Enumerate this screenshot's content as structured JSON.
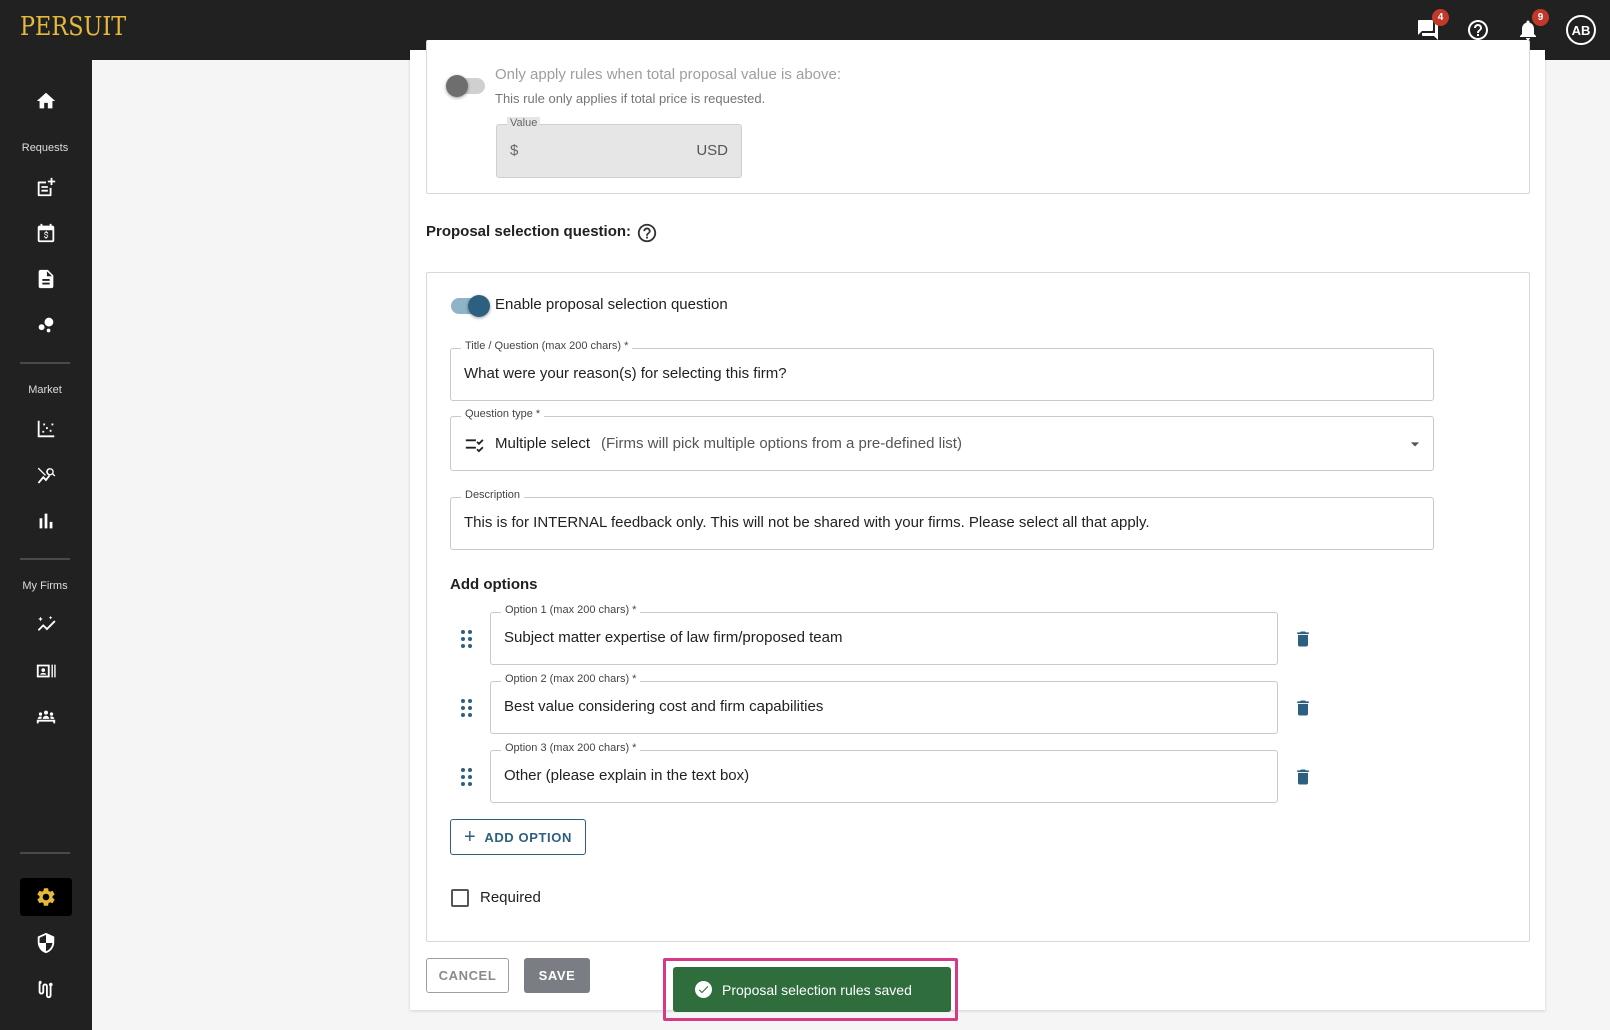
{
  "app": {
    "logo": "PERSUIT"
  },
  "topbar": {
    "messages_badge": "4",
    "notifications_badge": "9",
    "avatar_initials": "AB"
  },
  "sidebar": {
    "section_requests": "Requests",
    "section_market": "Market",
    "section_my_firms": "My Firms"
  },
  "threshold": {
    "toggle_label": "Only apply rules when total proposal value is above:",
    "helper": "This rule only applies if total price is requested.",
    "value_label": "Value",
    "currency_symbol": "$",
    "currency_code": "USD",
    "enabled": false
  },
  "selection_question": {
    "heading": "Proposal selection question:",
    "enable_label": "Enable proposal selection question",
    "enabled": true,
    "title_label": "Title / Question (max 200 chars) *",
    "title_value": "What were your reason(s) for selecting this firm?",
    "type_label": "Question type *",
    "type_value": "Multiple select",
    "type_hint": "(Firms will pick multiple options from a pre-defined list)",
    "description_label": "Description",
    "description_value": "This is for INTERNAL feedback only. This will not be shared with your firms. Please select all that apply.",
    "options_heading": "Add options",
    "options": [
      {
        "label": "Option 1 (max 200 chars) *",
        "value": "Subject matter expertise of law firm/proposed team"
      },
      {
        "label": "Option 2 (max 200 chars) *",
        "value": "Best value considering cost and firm capabilities"
      },
      {
        "label": "Option 3 (max 200 chars) *",
        "value": "Other (please explain in the text box)"
      }
    ],
    "add_option_label": "ADD OPTION",
    "required_label": "Required",
    "required": false
  },
  "actions": {
    "cancel_label": "CANCEL",
    "save_label": "SAVE"
  },
  "snackbar": {
    "message": "Proposal selection rules saved"
  },
  "colors": {
    "accent": "#2d6080",
    "logo": "#e6b93a",
    "success": "#2f6d3d",
    "highlight": "#d63a86",
    "topbar": "#212121"
  }
}
